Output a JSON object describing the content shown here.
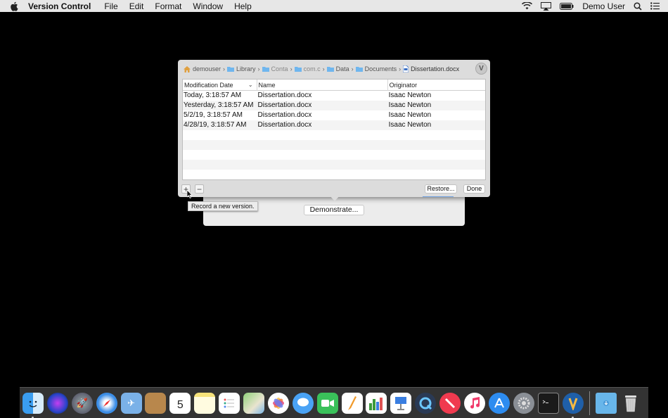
{
  "menubar": {
    "app_name": "Version Control",
    "items": [
      "File",
      "Edit",
      "Format",
      "Window",
      "Help"
    ],
    "user": "Demo User"
  },
  "path": [
    {
      "label": "demouser",
      "icon": "home-icon"
    },
    {
      "label": "Library",
      "icon": "folder-icon"
    },
    {
      "label": "Conta",
      "icon": "folder-icon"
    },
    {
      "label": "com.c",
      "icon": "folder-icon"
    },
    {
      "label": "Data",
      "icon": "folder-icon"
    },
    {
      "label": "Documents",
      "icon": "folder-icon"
    },
    {
      "label": "Dissertation.docx",
      "icon": "document-icon"
    }
  ],
  "table": {
    "columns": [
      "Modification Date",
      "Name",
      "Originator"
    ],
    "rows": [
      {
        "date": "Today, 3:18:57 AM",
        "name": "Dissertation.docx",
        "originator": "Isaac Newton"
      },
      {
        "date": "Yesterday, 3:18:57 AM",
        "name": "Dissertation.docx",
        "originator": "Isaac Newton"
      },
      {
        "date": "5/2/19, 3:18:57 AM",
        "name": "Dissertation.docx",
        "originator": "Isaac Newton"
      },
      {
        "date": "4/28/19, 3:18:57 AM",
        "name": "Dissertation.docx",
        "originator": "Isaac Newton"
      }
    ]
  },
  "buttons": {
    "add": "+",
    "remove": "−",
    "restore": "Restore...",
    "done": "Done",
    "demonstrate": "Demonstrate..."
  },
  "tooltip": "Record a new version.",
  "dock": {
    "calendar_day": "5",
    "icons": [
      "finder-icon",
      "siri-icon",
      "launchpad-icon",
      "safari-icon",
      "mail-icon",
      "contacts-icon",
      "calendar-icon",
      "notes-icon",
      "reminders-icon",
      "maps-icon",
      "photos-icon",
      "messages-icon",
      "facetime-icon",
      "pages-icon",
      "numbers-icon",
      "keynote-icon",
      "quicktime-icon",
      "news-icon",
      "music-icon",
      "app-store-icon",
      "system-preferences-icon",
      "terminal-icon",
      "version-control-icon"
    ],
    "right_icons": [
      "downloads-folder-icon",
      "trash-icon"
    ]
  }
}
